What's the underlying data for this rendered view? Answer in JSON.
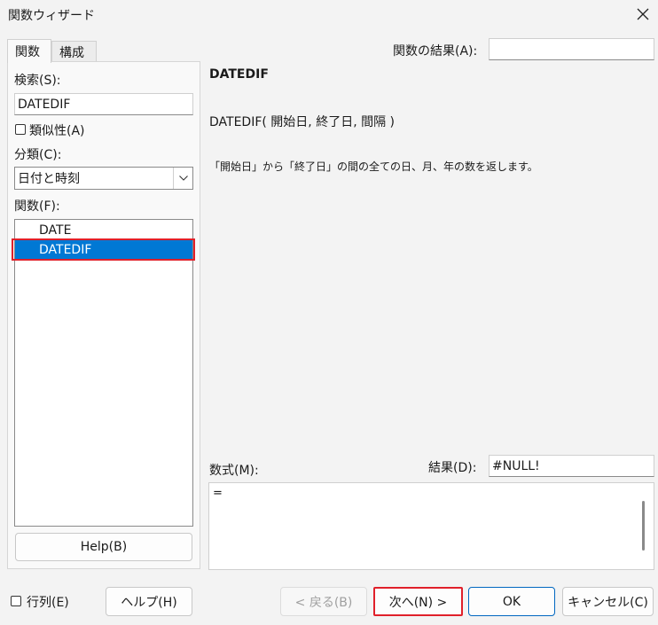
{
  "window": {
    "title": "関数ウィザード"
  },
  "tabs": [
    {
      "label": "関数"
    },
    {
      "label": "構成"
    }
  ],
  "search": {
    "label": "検索(S):",
    "value": "DATEDIF"
  },
  "similar": {
    "label": "類似性(A)"
  },
  "category": {
    "label": "分類(C):",
    "value": "日付と時刻"
  },
  "functions": {
    "label": "関数(F):",
    "items": [
      {
        "label": "DATE"
      },
      {
        "label": "DATEDIF"
      }
    ]
  },
  "help_button": "Help(B)",
  "function_result": {
    "label": "関数の結果(A):",
    "value": ""
  },
  "description": {
    "name": "DATEDIF",
    "syntax": "DATEDIF( 開始日, 終了日, 間隔 )",
    "text": "「開始日」から「終了日」の間の全ての日、月、年の数を返します。"
  },
  "formula": {
    "label": "数式(M):",
    "value": "="
  },
  "result": {
    "label": "結果(D):",
    "value": "#NULL!"
  },
  "array": {
    "label": "行列(E)"
  },
  "buttons": {
    "help": "ヘルプ(H)",
    "back": "< 戻る(B)",
    "next": "次へ(N) >",
    "ok": "OK",
    "cancel": "キャンセル(C)"
  }
}
